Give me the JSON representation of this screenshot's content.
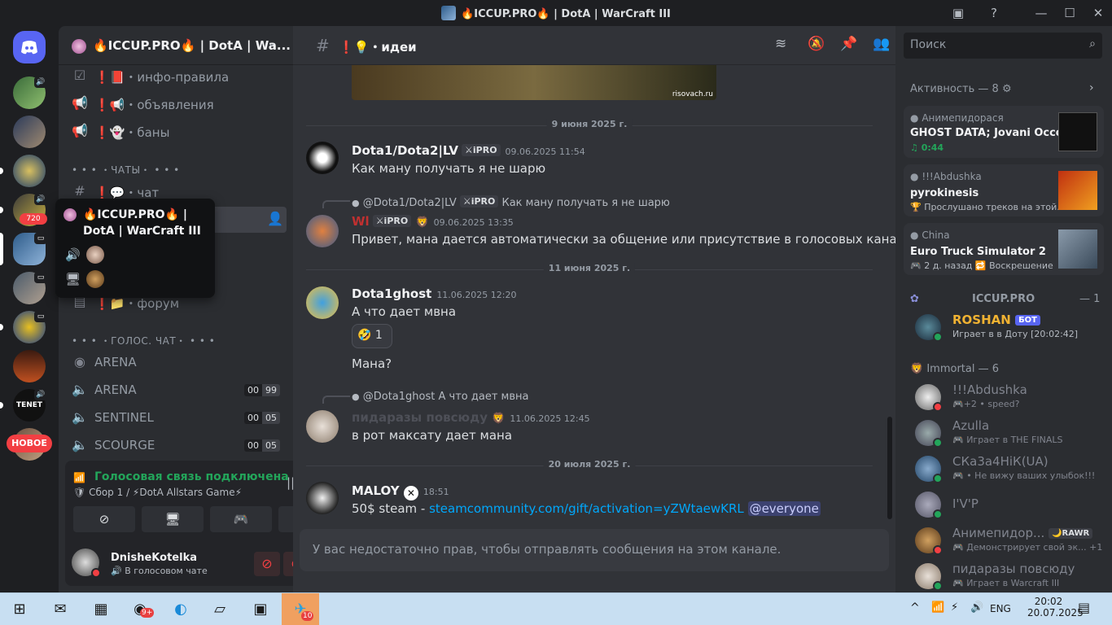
{
  "window": {
    "title": "🔥ICCUP.PRO🔥 | DotA | WarCraft III",
    "inbox_icon": "inbox-icon",
    "help_icon": "help-icon"
  },
  "rail": {
    "notification_badge": "720",
    "new_badge": "НОВОЕ",
    "tenet_label": "TENET"
  },
  "sidebar": {
    "server_name": "🔥ICCUP.PRO🔥 | DotA | Wa...",
    "channels": [
      {
        "name": "❗📕・инфо-правила",
        "icon": "rules-icon"
      },
      {
        "name": "❗📢・объявления",
        "icon": "announcement-icon"
      },
      {
        "name": "❗👻・баны",
        "icon": "announcement-icon"
      }
    ],
    "category_chats": "• • • ・ЧАТЫ・ • • •",
    "chat_channel": "❗💬・чат",
    "forum_channel": "❗📁・форум",
    "category_voice": "• • • ・ГОЛОС. ЧАТ・ • • •",
    "stage_channel": "ARENA",
    "voice_channels": [
      {
        "name": "ARENA",
        "count": "00",
        "limit": "99"
      },
      {
        "name": "SENTINEL",
        "count": "00",
        "limit": "05"
      },
      {
        "name": "SCOURGE",
        "count": "00",
        "limit": "05"
      }
    ]
  },
  "tooltip": {
    "server_name": "🔥ICCUP.PRO🔥 | DotA | WarCraft III"
  },
  "voice_panel": {
    "status": "Голосовая связь подключена",
    "channel": "Сбор 1 / ⚡DotA Allstars Game⚡"
  },
  "user": {
    "name": "DnisheKotelka",
    "status": "В голосовом чате"
  },
  "chat": {
    "channel_name": "❗💡・идеи",
    "image_watermark": "risovach.ru",
    "composer_placeholder": "У вас недостаточно прав, чтобы отправлять сообщения на этом канале.",
    "date_dividers": [
      "9 июня 2025 г.",
      "11 июня 2025 г.",
      "20 июля 2025 г."
    ],
    "messages": [
      {
        "author": "Dota1/Dota2|LV",
        "tag": "⚔iPRO",
        "time": "09.06.2025 11:54",
        "text": "Как ману получать я не шарю"
      },
      {
        "reply_author": "@Dota1/Dota2|LV",
        "reply_tag": "⚔iPRO",
        "reply_text": "Как ману получать я не шарю",
        "author": "Wl",
        "tag": "⚔iPRO",
        "time": "09.06.2025 13:35",
        "text": "Привет, мана дается автоматически за общение или присутствие в голосовых каналах"
      },
      {
        "author": "Dota1ghost",
        "time": "11.06.2025 12:20",
        "text": "А что дает мвна",
        "reaction_count": "1",
        "text2": "Мана?"
      },
      {
        "reply_author": "@Dota1ghost",
        "reply_text": "А что дает мвна",
        "author": "пидаразы повсюду",
        "time": "11.06.2025 12:45",
        "text": "в рот максату дает мана"
      },
      {
        "author": "MALOY",
        "time": "18:51",
        "text": "50$ steam - ",
        "link": "steamcommunity.com/gift/activation=yZWtaewKRL",
        "mention": "@everyone"
      }
    ]
  },
  "right": {
    "search_placeholder": "Поиск",
    "activity_title": "Активность — 8",
    "activities": [
      {
        "user": "Анимепидорася",
        "title": "GHOST DATA; Jovani Occo...",
        "detail": "♫ 0:44"
      },
      {
        "user": "!!!Abdushka",
        "title": "pyrokinesis",
        "detail": "🏆 Прослушано треков на этой..."
      },
      {
        "user": "China",
        "title": "Euro Truck Simulator 2",
        "detail": "🎮 2 д. назад 🔁 Воскрешение"
      }
    ],
    "group_iccup": "ICCUP.PRO",
    "group_iccup_count": "— 1",
    "bot": {
      "name": "ROSHAN",
      "badge": "БОТ",
      "status": "Играет в в Доту [20:02:42]"
    },
    "group_immortal": "Immortal — 6",
    "members": [
      {
        "name": "!!!Abdushka",
        "status": "🎮+2 • speed?",
        "dot": "#f23f43"
      },
      {
        "name": "Azulla",
        "status": "🎮 Играет в THE FINALS",
        "dot": "#23a55a"
      },
      {
        "name": "СКа3а4НiК(UA)",
        "status": "🎮 • Не вижу ваших улыбок!!!",
        "dot": "#23a55a"
      },
      {
        "name": "I'V'P",
        "status": "",
        "dot": "#23a55a"
      },
      {
        "name": "Анимепидор...",
        "tag": "🌙RAWR",
        "status": "🎮 Демонстрирует свой эк... +1",
        "dot": "#f23f43"
      },
      {
        "name": "пидаразы повсюду",
        "status": "🎮 Играет в Warcraft III",
        "dot": "#23a55a"
      }
    ]
  },
  "taskbar": {
    "time": "20:02",
    "date": "20.07.2025",
    "lang": "ENG",
    "telegram_badge": "10",
    "chrome_badge": "9+"
  }
}
